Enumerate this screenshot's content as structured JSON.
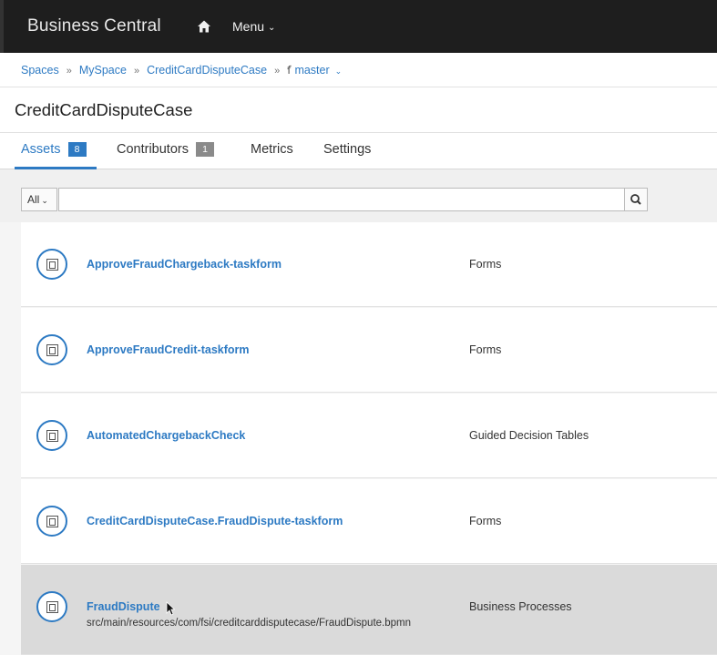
{
  "app": {
    "title": "Business Central",
    "menu_label": "Menu"
  },
  "breadcrumb": {
    "items": [
      "Spaces",
      "MySpace",
      "CreditCardDisputeCase"
    ],
    "branch": "master"
  },
  "page": {
    "title": "CreditCardDisputeCase"
  },
  "tabs": [
    {
      "label": "Assets",
      "badge": "8"
    },
    {
      "label": "Contributors",
      "badge": "1"
    },
    {
      "label": "Metrics"
    },
    {
      "label": "Settings"
    }
  ],
  "filter": {
    "selected": "All",
    "search_value": "",
    "search_placeholder": ""
  },
  "assets": [
    {
      "name": "ApproveFraudChargeback-taskform",
      "type": "Forms",
      "path": ""
    },
    {
      "name": "ApproveFraudCredit-taskform",
      "type": "Forms",
      "path": ""
    },
    {
      "name": "AutomatedChargebackCheck",
      "type": "Guided Decision Tables",
      "path": ""
    },
    {
      "name": "CreditCardDisputeCase.FraudDispute-taskform",
      "type": "Forms",
      "path": ""
    },
    {
      "name": "FraudDispute",
      "type": "Business Processes",
      "path": "src/main/resources/com/fsi/creditcarddisputecase/FraudDispute.bpmn"
    }
  ],
  "colors": {
    "accent": "#2d7ac3",
    "topbar": "#1e1e1e",
    "hover_row": "#dadada"
  },
  "icons": {
    "home": "home-icon",
    "search": "search-icon",
    "asset": "asset-file-icon",
    "branch": "branch-icon"
  }
}
